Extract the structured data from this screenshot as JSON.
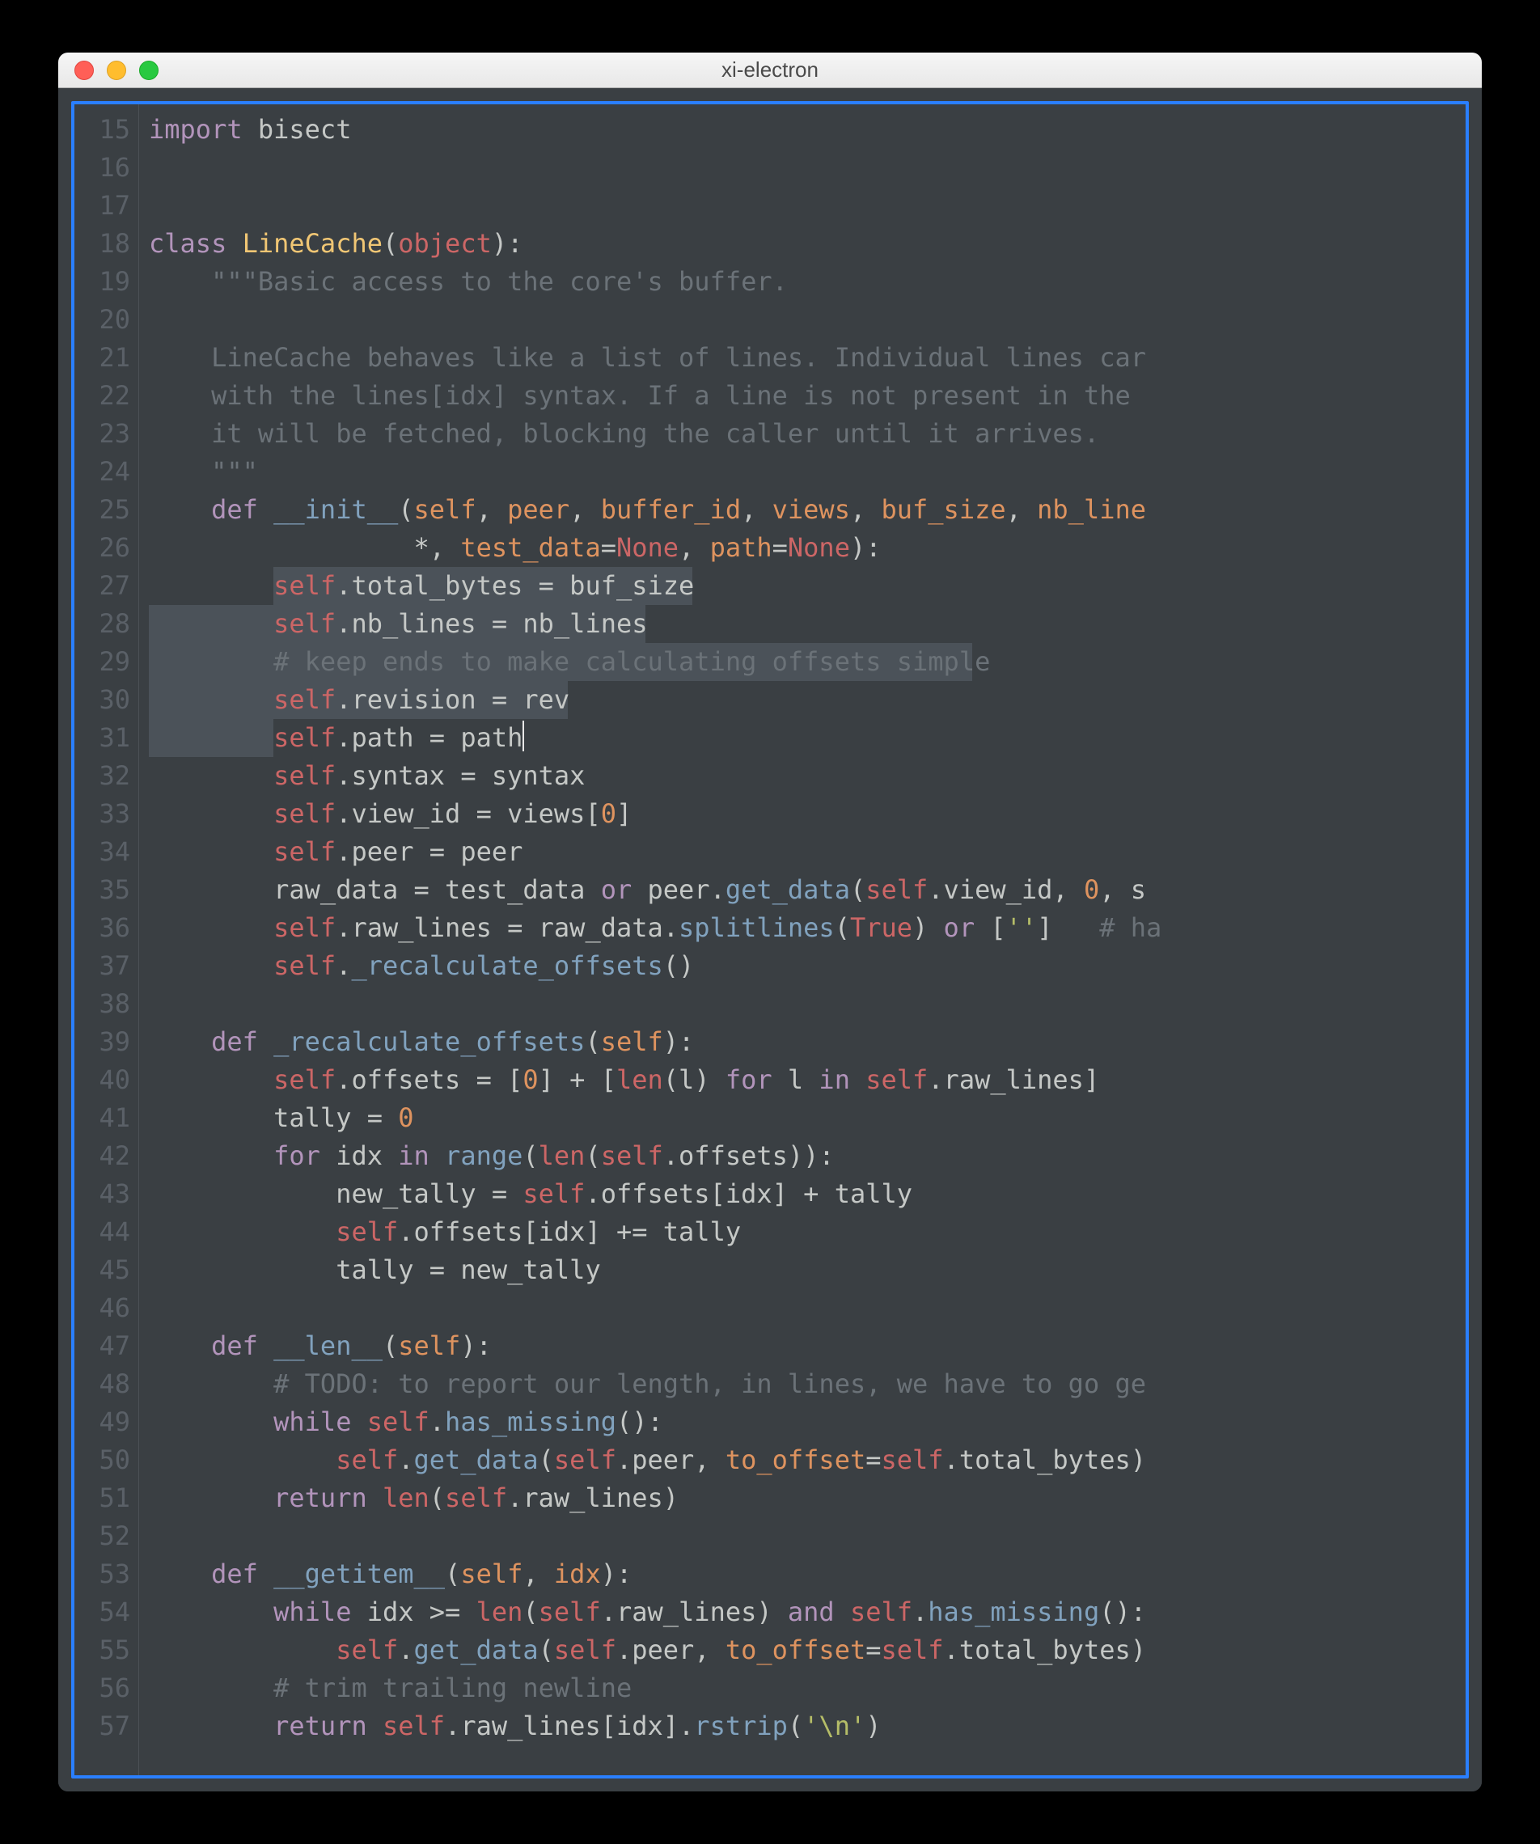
{
  "window": {
    "title": "xi-electron"
  },
  "gutter": {
    "start": 15,
    "end": 57
  },
  "selections": [
    {
      "line": 27,
      "startCh": 8,
      "endCh": 35
    },
    {
      "line": 28,
      "startCh": 0,
      "endCh": 32
    },
    {
      "line": 29,
      "startCh": 0,
      "endCh": 53
    },
    {
      "line": 30,
      "startCh": 0,
      "endCh": 27
    },
    {
      "line": 31,
      "startCh": 0,
      "endCh": 8
    }
  ],
  "cursor": {
    "line": 31,
    "afterCh": 24
  },
  "code": {
    "15": [
      {
        "t": "import ",
        "c": "kw"
      },
      {
        "t": "bisect",
        "c": "plain"
      }
    ],
    "16": [
      {
        "t": "",
        "c": "plain"
      }
    ],
    "17": [
      {
        "t": "",
        "c": "plain"
      }
    ],
    "18": [
      {
        "t": "class ",
        "c": "kw"
      },
      {
        "t": "LineCache",
        "c": "cls"
      },
      {
        "t": "(",
        "c": "plain"
      },
      {
        "t": "object",
        "c": "bltn"
      },
      {
        "t": "):",
        "c": "plain"
      }
    ],
    "19": [
      {
        "t": "    ",
        "c": "plain"
      },
      {
        "t": "\"\"\"Basic access to the core's buffer.",
        "c": "cmt"
      }
    ],
    "20": [
      {
        "t": "",
        "c": "plain"
      }
    ],
    "21": [
      {
        "t": "    LineCache behaves like a list of lines. Individual lines car",
        "c": "cmt"
      }
    ],
    "22": [
      {
        "t": "    with the lines[idx] syntax. If a line is not present in the ",
        "c": "cmt"
      }
    ],
    "23": [
      {
        "t": "    it will be fetched, blocking the caller until it arrives.",
        "c": "cmt"
      }
    ],
    "24": [
      {
        "t": "    ",
        "c": "plain"
      },
      {
        "t": "\"\"\"",
        "c": "cmt"
      }
    ],
    "25": [
      {
        "t": "    ",
        "c": "plain"
      },
      {
        "t": "def ",
        "c": "kw"
      },
      {
        "t": "__init__",
        "c": "fn"
      },
      {
        "t": "(",
        "c": "plain"
      },
      {
        "t": "self",
        "c": "arg"
      },
      {
        "t": ", ",
        "c": "plain"
      },
      {
        "t": "peer",
        "c": "arg"
      },
      {
        "t": ", ",
        "c": "plain"
      },
      {
        "t": "buffer_id",
        "c": "arg"
      },
      {
        "t": ", ",
        "c": "plain"
      },
      {
        "t": "views",
        "c": "arg"
      },
      {
        "t": ", ",
        "c": "plain"
      },
      {
        "t": "buf_size",
        "c": "arg"
      },
      {
        "t": ", ",
        "c": "plain"
      },
      {
        "t": "nb_line",
        "c": "arg"
      }
    ],
    "26": [
      {
        "t": "                 ",
        "c": "plain"
      },
      {
        "t": "*",
        "c": "op"
      },
      {
        "t": ", ",
        "c": "plain"
      },
      {
        "t": "test_data",
        "c": "arg"
      },
      {
        "t": "=",
        "c": "op"
      },
      {
        "t": "None",
        "c": "bltn"
      },
      {
        "t": ", ",
        "c": "plain"
      },
      {
        "t": "path",
        "c": "arg"
      },
      {
        "t": "=",
        "c": "op"
      },
      {
        "t": "None",
        "c": "bltn"
      },
      {
        "t": "):",
        "c": "plain"
      }
    ],
    "27": [
      {
        "t": "        ",
        "c": "plain"
      },
      {
        "t": "self",
        "c": "self"
      },
      {
        "t": ".total_bytes = buf_size",
        "c": "plain"
      }
    ],
    "28": [
      {
        "t": "        ",
        "c": "plain"
      },
      {
        "t": "self",
        "c": "self"
      },
      {
        "t": ".nb_lines = nb_lines",
        "c": "plain"
      }
    ],
    "29": [
      {
        "t": "        ",
        "c": "plain"
      },
      {
        "t": "# keep ends to make calculating offsets simple",
        "c": "cmt"
      }
    ],
    "30": [
      {
        "t": "        ",
        "c": "plain"
      },
      {
        "t": "self",
        "c": "self"
      },
      {
        "t": ".revision = rev",
        "c": "plain"
      }
    ],
    "31": [
      {
        "t": "        ",
        "c": "plain"
      },
      {
        "t": "self",
        "c": "self"
      },
      {
        "t": ".path = path",
        "c": "plain"
      }
    ],
    "32": [
      {
        "t": "        ",
        "c": "plain"
      },
      {
        "t": "self",
        "c": "self"
      },
      {
        "t": ".syntax = syntax",
        "c": "plain"
      }
    ],
    "33": [
      {
        "t": "        ",
        "c": "plain"
      },
      {
        "t": "self",
        "c": "self"
      },
      {
        "t": ".view_id = views[",
        "c": "plain"
      },
      {
        "t": "0",
        "c": "num"
      },
      {
        "t": "]",
        "c": "plain"
      }
    ],
    "34": [
      {
        "t": "        ",
        "c": "plain"
      },
      {
        "t": "self",
        "c": "self"
      },
      {
        "t": ".peer = peer",
        "c": "plain"
      }
    ],
    "35": [
      {
        "t": "        raw_data = test_data ",
        "c": "plain"
      },
      {
        "t": "or",
        "c": "kw"
      },
      {
        "t": " peer.",
        "c": "plain"
      },
      {
        "t": "get_data",
        "c": "fn"
      },
      {
        "t": "(",
        "c": "plain"
      },
      {
        "t": "self",
        "c": "self"
      },
      {
        "t": ".view_id, ",
        "c": "plain"
      },
      {
        "t": "0",
        "c": "num"
      },
      {
        "t": ", s",
        "c": "plain"
      }
    ],
    "36": [
      {
        "t": "        ",
        "c": "plain"
      },
      {
        "t": "self",
        "c": "self"
      },
      {
        "t": ".raw_lines = raw_data.",
        "c": "plain"
      },
      {
        "t": "splitlines",
        "c": "fn"
      },
      {
        "t": "(",
        "c": "plain"
      },
      {
        "t": "True",
        "c": "bltn"
      },
      {
        "t": ") ",
        "c": "plain"
      },
      {
        "t": "or",
        "c": "kw"
      },
      {
        "t": " [",
        "c": "plain"
      },
      {
        "t": "''",
        "c": "str"
      },
      {
        "t": "]   ",
        "c": "plain"
      },
      {
        "t": "# ha",
        "c": "cmt"
      }
    ],
    "37": [
      {
        "t": "        ",
        "c": "plain"
      },
      {
        "t": "self",
        "c": "self"
      },
      {
        "t": ".",
        "c": "plain"
      },
      {
        "t": "_recalculate_offsets",
        "c": "fn"
      },
      {
        "t": "()",
        "c": "plain"
      }
    ],
    "38": [
      {
        "t": "",
        "c": "plain"
      }
    ],
    "39": [
      {
        "t": "    ",
        "c": "plain"
      },
      {
        "t": "def ",
        "c": "kw"
      },
      {
        "t": "_recalculate_offsets",
        "c": "fn"
      },
      {
        "t": "(",
        "c": "plain"
      },
      {
        "t": "self",
        "c": "arg"
      },
      {
        "t": "):",
        "c": "plain"
      }
    ],
    "40": [
      {
        "t": "        ",
        "c": "plain"
      },
      {
        "t": "self",
        "c": "self"
      },
      {
        "t": ".offsets = [",
        "c": "plain"
      },
      {
        "t": "0",
        "c": "num"
      },
      {
        "t": "] + [",
        "c": "plain"
      },
      {
        "t": "len",
        "c": "bltn"
      },
      {
        "t": "(l) ",
        "c": "plain"
      },
      {
        "t": "for",
        "c": "kw"
      },
      {
        "t": " l ",
        "c": "plain"
      },
      {
        "t": "in",
        "c": "kw"
      },
      {
        "t": " ",
        "c": "plain"
      },
      {
        "t": "self",
        "c": "self"
      },
      {
        "t": ".raw_lines]",
        "c": "plain"
      }
    ],
    "41": [
      {
        "t": "        tally = ",
        "c": "plain"
      },
      {
        "t": "0",
        "c": "num"
      }
    ],
    "42": [
      {
        "t": "        ",
        "c": "plain"
      },
      {
        "t": "for",
        "c": "kw"
      },
      {
        "t": " idx ",
        "c": "plain"
      },
      {
        "t": "in",
        "c": "kw"
      },
      {
        "t": " ",
        "c": "plain"
      },
      {
        "t": "range",
        "c": "fn"
      },
      {
        "t": "(",
        "c": "plain"
      },
      {
        "t": "len",
        "c": "bltn"
      },
      {
        "t": "(",
        "c": "plain"
      },
      {
        "t": "self",
        "c": "self"
      },
      {
        "t": ".offsets)):",
        "c": "plain"
      }
    ],
    "43": [
      {
        "t": "            new_tally = ",
        "c": "plain"
      },
      {
        "t": "self",
        "c": "self"
      },
      {
        "t": ".offsets[idx] + tally",
        "c": "plain"
      }
    ],
    "44": [
      {
        "t": "            ",
        "c": "plain"
      },
      {
        "t": "self",
        "c": "self"
      },
      {
        "t": ".offsets[idx] += tally",
        "c": "plain"
      }
    ],
    "45": [
      {
        "t": "            tally = new_tally",
        "c": "plain"
      }
    ],
    "46": [
      {
        "t": "",
        "c": "plain"
      }
    ],
    "47": [
      {
        "t": "    ",
        "c": "plain"
      },
      {
        "t": "def ",
        "c": "kw"
      },
      {
        "t": "__len__",
        "c": "fn"
      },
      {
        "t": "(",
        "c": "plain"
      },
      {
        "t": "self",
        "c": "arg"
      },
      {
        "t": "):",
        "c": "plain"
      }
    ],
    "48": [
      {
        "t": "        ",
        "c": "plain"
      },
      {
        "t": "# TODO: to report our length, in lines, we have to go ge",
        "c": "cmt"
      }
    ],
    "49": [
      {
        "t": "        ",
        "c": "plain"
      },
      {
        "t": "while",
        "c": "kw"
      },
      {
        "t": " ",
        "c": "plain"
      },
      {
        "t": "self",
        "c": "self"
      },
      {
        "t": ".",
        "c": "plain"
      },
      {
        "t": "has_missing",
        "c": "fn"
      },
      {
        "t": "():",
        "c": "plain"
      }
    ],
    "50": [
      {
        "t": "            ",
        "c": "plain"
      },
      {
        "t": "self",
        "c": "self"
      },
      {
        "t": ".",
        "c": "plain"
      },
      {
        "t": "get_data",
        "c": "fn"
      },
      {
        "t": "(",
        "c": "plain"
      },
      {
        "t": "self",
        "c": "self"
      },
      {
        "t": ".peer, ",
        "c": "plain"
      },
      {
        "t": "to_offset",
        "c": "arg"
      },
      {
        "t": "=",
        "c": "op"
      },
      {
        "t": "self",
        "c": "self"
      },
      {
        "t": ".total_bytes)",
        "c": "plain"
      }
    ],
    "51": [
      {
        "t": "        ",
        "c": "plain"
      },
      {
        "t": "return",
        "c": "kw"
      },
      {
        "t": " ",
        "c": "plain"
      },
      {
        "t": "len",
        "c": "bltn"
      },
      {
        "t": "(",
        "c": "plain"
      },
      {
        "t": "self",
        "c": "self"
      },
      {
        "t": ".raw_lines)",
        "c": "plain"
      }
    ],
    "52": [
      {
        "t": "",
        "c": "plain"
      }
    ],
    "53": [
      {
        "t": "    ",
        "c": "plain"
      },
      {
        "t": "def ",
        "c": "kw"
      },
      {
        "t": "__getitem__",
        "c": "fn"
      },
      {
        "t": "(",
        "c": "plain"
      },
      {
        "t": "self",
        "c": "arg"
      },
      {
        "t": ", ",
        "c": "plain"
      },
      {
        "t": "idx",
        "c": "arg"
      },
      {
        "t": "):",
        "c": "plain"
      }
    ],
    "54": [
      {
        "t": "        ",
        "c": "plain"
      },
      {
        "t": "while",
        "c": "kw"
      },
      {
        "t": " idx >= ",
        "c": "plain"
      },
      {
        "t": "len",
        "c": "bltn"
      },
      {
        "t": "(",
        "c": "plain"
      },
      {
        "t": "self",
        "c": "self"
      },
      {
        "t": ".raw_lines) ",
        "c": "plain"
      },
      {
        "t": "and",
        "c": "kw"
      },
      {
        "t": " ",
        "c": "plain"
      },
      {
        "t": "self",
        "c": "self"
      },
      {
        "t": ".",
        "c": "plain"
      },
      {
        "t": "has_missing",
        "c": "fn"
      },
      {
        "t": "():",
        "c": "plain"
      }
    ],
    "55": [
      {
        "t": "            ",
        "c": "plain"
      },
      {
        "t": "self",
        "c": "self"
      },
      {
        "t": ".",
        "c": "plain"
      },
      {
        "t": "get_data",
        "c": "fn"
      },
      {
        "t": "(",
        "c": "plain"
      },
      {
        "t": "self",
        "c": "self"
      },
      {
        "t": ".peer, ",
        "c": "plain"
      },
      {
        "t": "to_offset",
        "c": "arg"
      },
      {
        "t": "=",
        "c": "op"
      },
      {
        "t": "self",
        "c": "self"
      },
      {
        "t": ".total_bytes)",
        "c": "plain"
      }
    ],
    "56": [
      {
        "t": "        ",
        "c": "plain"
      },
      {
        "t": "# trim trailing newline",
        "c": "cmt"
      }
    ],
    "57": [
      {
        "t": "        ",
        "c": "plain"
      },
      {
        "t": "return",
        "c": "kw"
      },
      {
        "t": " ",
        "c": "plain"
      },
      {
        "t": "self",
        "c": "self"
      },
      {
        "t": ".raw_lines[idx].",
        "c": "plain"
      },
      {
        "t": "rstrip",
        "c": "fn"
      },
      {
        "t": "(",
        "c": "plain"
      },
      {
        "t": "'\\n'",
        "c": "str"
      },
      {
        "t": ")",
        "c": "plain"
      }
    ]
  }
}
